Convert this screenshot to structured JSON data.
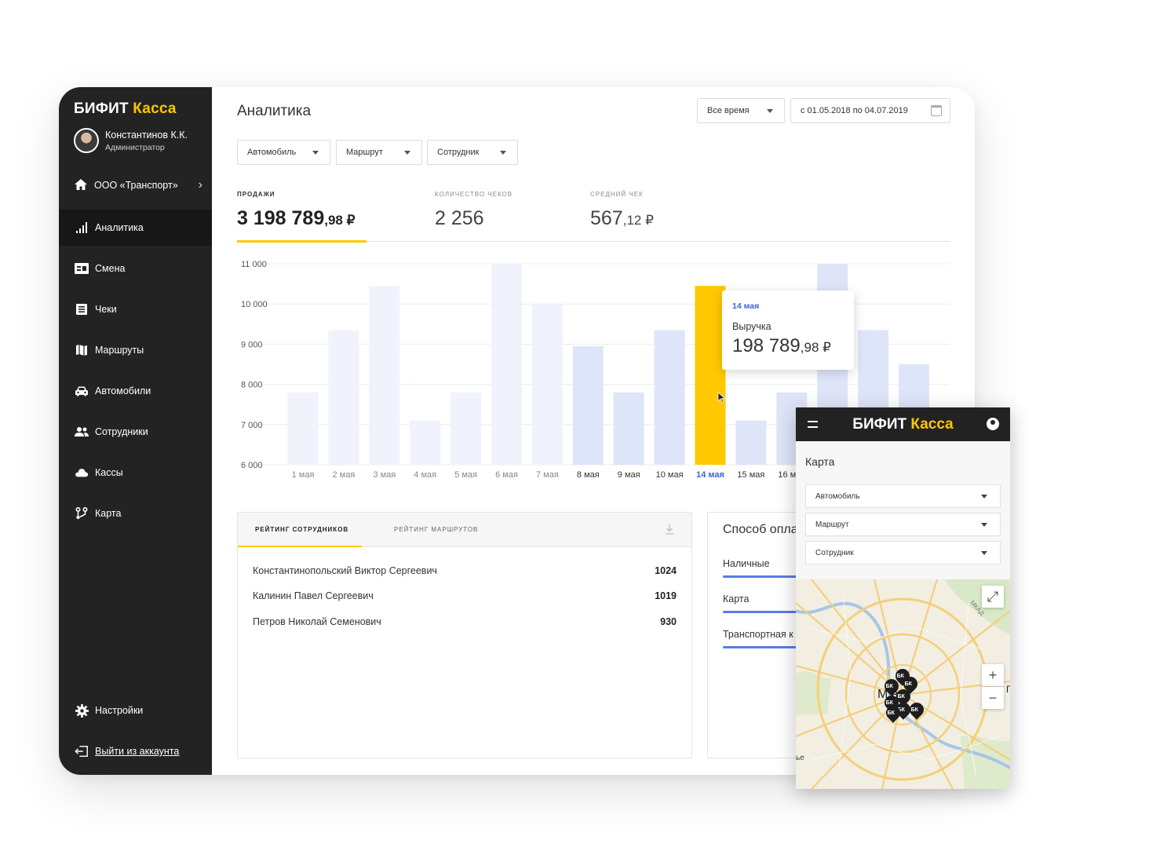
{
  "brand": {
    "part1": "БИФИТ",
    "part2": "Касса"
  },
  "user": {
    "name": "Константинов К.К.",
    "role": "Администратор"
  },
  "org": {
    "label": "ООО «Транспорт»"
  },
  "sidebar": {
    "items": [
      {
        "label": "Аналитика",
        "icon": "bar-chart-icon"
      },
      {
        "label": "Смена",
        "icon": "shift-icon"
      },
      {
        "label": "Чеки",
        "icon": "receipt-icon"
      },
      {
        "label": "Маршруты",
        "icon": "map-book-icon"
      },
      {
        "label": "Автомобили",
        "icon": "car-icon"
      },
      {
        "label": "Сотрудники",
        "icon": "people-icon"
      },
      {
        "label": "Кассы",
        "icon": "cloud-icon"
      },
      {
        "label": "Карта",
        "icon": "route-icon"
      }
    ],
    "settings": "Настройки",
    "logout": "Выйти из аккаунта"
  },
  "header": {
    "title": "Аналитика",
    "period": "Все время",
    "date_range": "с 01.05.2018 по 04.07.2019"
  },
  "filters": {
    "car": "Автомобиль",
    "route": "Маршрут",
    "employee": "Сотрудник"
  },
  "kpis": {
    "sales": {
      "label": "ПРОДАЖИ",
      "main": "3 198 789",
      "cents": ",98 ₽"
    },
    "checks": {
      "label": "КОЛИЧЕСТВО ЧЕКОВ",
      "main": "2 256"
    },
    "avg": {
      "label": "СРЕДНИЙ ЧЕК",
      "main": "567",
      "cents": ",12 ₽"
    }
  },
  "chart_data": {
    "type": "bar",
    "categories": [
      "1 мая",
      "2 мая",
      "3 мая",
      "4 мая",
      "5 мая",
      "6 мая",
      "7 мая",
      "8 мая",
      "9 мая",
      "10 мая",
      "14 мая",
      "15 мая",
      "16 мая",
      "",
      "",
      ""
    ],
    "values": [
      7800,
      9350,
      10450,
      7100,
      7800,
      11000,
      10000,
      8950,
      7800,
      9350,
      10450,
      7100,
      7800,
      11000,
      9350,
      8500
    ],
    "highlight_index": 10,
    "ylim": [
      6000,
      11000
    ],
    "yticks": [
      "11 000",
      "10 000",
      "9 000",
      "8 000",
      "7 000",
      "6 000"
    ],
    "colors": {
      "faded": "#f0f3fc",
      "normal": "#dfe5f9",
      "highlight": "#ffc800"
    },
    "tooltip": {
      "date": "14 мая",
      "label": "Выручка",
      "main": "198 789",
      "cents": ",98 ₽"
    }
  },
  "ranking": {
    "tab_employees": "РЕЙТИНГ СОТРУДНИКОВ",
    "tab_routes": "РЕЙТИНГ МАРШРУТОВ",
    "rows": [
      {
        "name": "Константинопольский Виктор Сергеевич",
        "value": "1024"
      },
      {
        "name": "Калинин Павел Сергеевич",
        "value": "1019"
      },
      {
        "name": "Петров Николай Семенович",
        "value": "930"
      }
    ]
  },
  "payment": {
    "title": "Способ опла",
    "items": [
      {
        "label": "Наличные"
      },
      {
        "label": "Карта"
      },
      {
        "label": "Транспортная к"
      }
    ]
  },
  "mobile": {
    "brand1": "БИФИТ",
    "brand2": "Касса",
    "title": "Карта",
    "filters": [
      "Автомобиль",
      "Маршрут",
      "Сотрудник"
    ],
    "map": {
      "city": "М    ва",
      "pin_label": "БК",
      "road_label": "МКАД",
      "edge_left": "ье",
      "edge_right": "Г",
      "zoom_in": "+",
      "zoom_out": "−"
    }
  }
}
